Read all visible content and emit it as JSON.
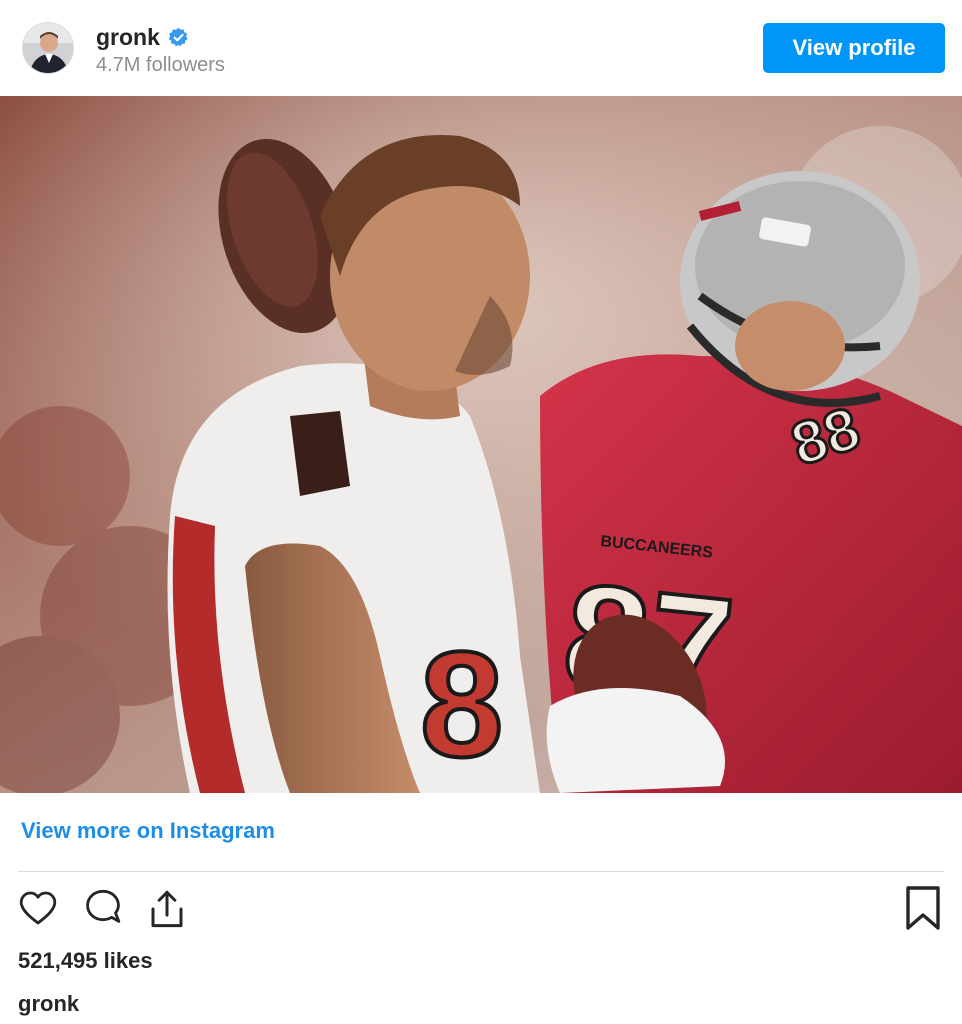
{
  "header": {
    "username": "gronk",
    "followers": "4.7M followers",
    "view_profile_label": "View profile",
    "verified_icon": "verified-badge-icon",
    "avatar_icon": "avatar"
  },
  "post": {
    "image_semantic": "football-players-buccaneers-photo",
    "view_more_label": "View more on Instagram"
  },
  "actions": {
    "like_icon": "heart-icon",
    "comment_icon": "comment-icon",
    "share_icon": "share-icon",
    "save_icon": "bookmark-icon"
  },
  "likes": "521,495 likes",
  "caption_username": "gronk",
  "colors": {
    "brand_blue": "#0095f6",
    "link_blue": "#1c8ee8",
    "text": "#262626",
    "muted": "#8e8e8e"
  }
}
